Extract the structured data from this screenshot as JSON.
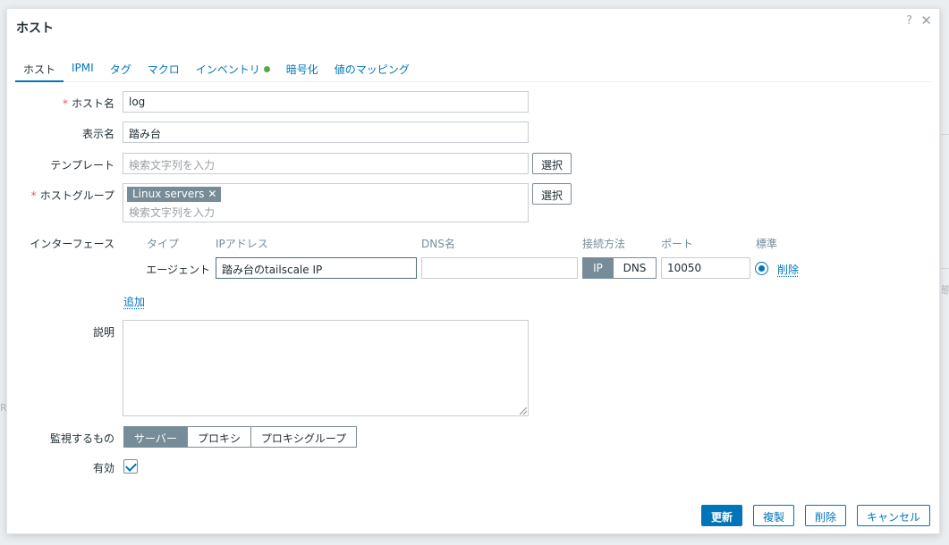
{
  "dialog": {
    "title": "ホスト",
    "help_icon": "?",
    "close_icon": "✕"
  },
  "tabs": [
    {
      "label": "ホスト",
      "active": true
    },
    {
      "label": "IPMI"
    },
    {
      "label": "タグ"
    },
    {
      "label": "マクロ"
    },
    {
      "label": "インベントリ",
      "indicator_color": "#59a84b"
    },
    {
      "label": "暗号化"
    },
    {
      "label": "値のマッピング"
    }
  ],
  "form": {
    "required_mark": "*",
    "host_name": {
      "label": "ホスト名",
      "value": "log"
    },
    "visible_name": {
      "label": "表示名",
      "value": "踏み台"
    },
    "templates": {
      "label": "テンプレート",
      "placeholder": "検索文字列を入力",
      "select_label": "選択"
    },
    "host_groups": {
      "label": "ホストグループ",
      "tag": "Linux servers",
      "tag_remove": "✕",
      "placeholder": "検索文字列を入力",
      "select_label": "選択"
    },
    "interfaces": {
      "label": "インターフェース",
      "columns": {
        "type": "タイプ",
        "ip": "IPアドレス",
        "dns": "DNS名",
        "connect": "接続方法",
        "port": "ポート",
        "default": "標準"
      },
      "row": {
        "type": "エージェント",
        "ip": "踏み台のtailscale IP",
        "dns": "",
        "connect_ip": "IP",
        "connect_dns": "DNS",
        "port": "10050",
        "remove": "削除"
      },
      "add": "追加"
    },
    "description": {
      "label": "説明",
      "value": ""
    },
    "monitored_by": {
      "label": "監視するもの",
      "options": [
        "サーバー",
        "プロキシ",
        "プロキシグループ"
      ],
      "selected": "サーバー"
    },
    "enabled": {
      "label": "有効",
      "checked": true
    }
  },
  "footer": {
    "update": "更新",
    "clone": "複製",
    "delete": "削除",
    "cancel": "キャンセル"
  },
  "background": {
    "fragment_right": "態",
    "fragment_left": "R"
  },
  "colors": {
    "accent": "#0275b8",
    "segment_active": "#768d99",
    "required": "#e45959"
  }
}
